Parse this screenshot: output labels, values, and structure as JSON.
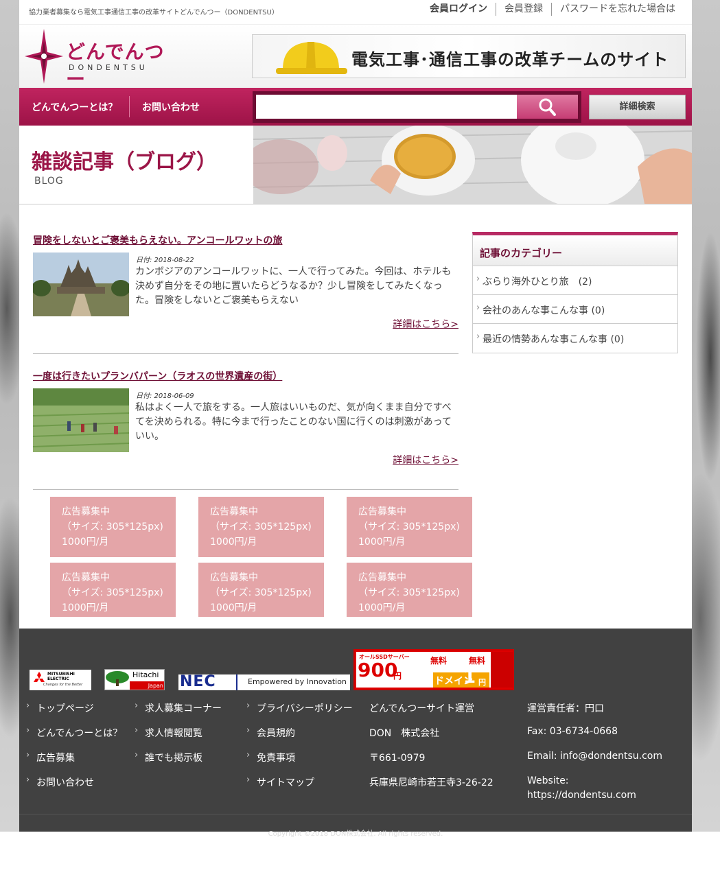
{
  "topbar": {
    "tagline": "協力業者募集なら電気工事通信工事の改革サイトどんでんつー（DONDENTSU）",
    "login": "会員ログイン",
    "register": "会員登録",
    "forgot": "パスワードを忘れた場合は"
  },
  "header": {
    "logo_text": "どんでんつー",
    "logo_sub": "DONDENTSU",
    "banner_text": "電気工事･通信工事の改革チームのサイト"
  },
  "nav": {
    "about": "どんでんつーとは？",
    "contact": "お問い合わせ",
    "search_placeholder": "",
    "advanced_search": "詳細検索"
  },
  "title_band": {
    "title": "雑談記事（ブログ）",
    "subtitle": "BLOG"
  },
  "articles": [
    {
      "title": "冒険をしないとご褒美もらえない。アンコールワットの旅",
      "date": "日付: 2018-08-22",
      "excerpt": "カンボジアのアンコールワットに、一人で行ってみた。今回は、ホテルも決めず自分をその地に置いたらどうなるか？少し冒険をしてみたくなった。冒険をしないとご褒美もらえない",
      "more": "詳細はこちら>"
    },
    {
      "title": "一度は行きたいプランバパーン（ラオスの世界遺産の街）",
      "date": "日付: 2018-06-09",
      "excerpt": "私はよく一人で旅をする。一人旅はいいものだ、気が向くまま自分ですべてを決められる。特に今まで行ったことのない国に行くのは刺激があっていい。",
      "more": "詳細はこちら>"
    }
  ],
  "sidebar": {
    "heading": "記事のカテゴリー",
    "items": [
      "ぶらり海外ひとり旅　(2)",
      "会社のあんな事こんな事 (0)",
      "最近の情勢あんな事こんな事 (0)"
    ]
  },
  "ads": {
    "line1": "広告募集中",
    "line2": "（サイズ: 305*125px)",
    "line3": "1000円/月"
  },
  "partners": {
    "mitsubishi": "MITSUBISHI ELECTRIC",
    "mitsubishi_tag": "Changes for the Better",
    "hitachi": "Hitachi",
    "hitachi_sub": "Japan",
    "nec": "NEC",
    "nec_tag": "Empowered by Innovation",
    "onamae_top": "オールSSDサーバー",
    "onamae_price": "900",
    "onamae_unit": "円",
    "onamae_free1": "無料",
    "onamae_free2": "無料",
    "onamae_domain": "ドメイン",
    "onamae_one": "1",
    "onamae_yen": "円"
  },
  "footer": {
    "col1": [
      "トップページ",
      "どんでんつーとは？",
      "広告募集",
      "お問い合わせ"
    ],
    "col2": [
      "求人募集コーナー",
      "求人情報閲覧",
      "誰でも掲示板"
    ],
    "col3": [
      "プライバシーポリシー",
      "会員規約",
      "免責事項",
      "サイトマップ"
    ],
    "company": [
      "どんでんつーサイト運営",
      "DON　株式会社",
      "〒661-0979",
      "兵庫県尼崎市若王寺3-26-22"
    ],
    "contact": [
      "運営責任者：円口",
      "Fax: 03-6734-0668",
      "Email: info@dondentsu.com",
      "Website:",
      "https://dondentsu.com"
    ],
    "copyright": "Copyright ©2018 DON株式会社. All rights reserved."
  },
  "colors": {
    "brand": "#b01857",
    "nav": "#9d1347",
    "ad_bg": "#e4a5a8",
    "footer_bg": "#414141"
  }
}
